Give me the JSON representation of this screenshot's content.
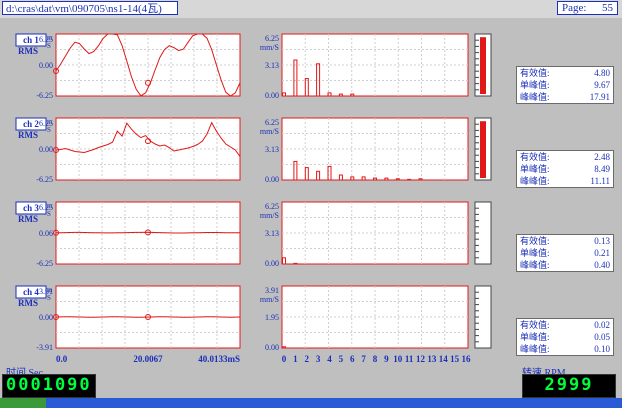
{
  "header": {
    "file_path": "d:\\cras\\dat\\vm\\090705\\ns1-14(4瓦)",
    "page_label": "Page:",
    "page_number": "55"
  },
  "colors": {
    "trace": "#e01818",
    "axis_text": "#1b2fb8",
    "bar_fill": "#e01818",
    "background": "#bfbfbf"
  },
  "channels": [
    {
      "label": "ch 1",
      "rms_label": "RMS",
      "side_marks": [
        "m",
        "S"
      ],
      "wave_ticks": [
        "6.25",
        "0.00",
        "-6.25"
      ],
      "spec_unit": "mm/S",
      "spec_ticks": [
        "6.25",
        "3.13",
        "0.00"
      ],
      "stats": [
        {
          "key": "有效值:",
          "value": "4.80"
        },
        {
          "key": "单峰值:",
          "value": "9.67"
        },
        {
          "key": "峰峰值:",
          "value": "17.91"
        }
      ],
      "level": 0.98,
      "spectrum": [
        0.05,
        0.58,
        0.28,
        0.52,
        0.05,
        0.03,
        0.03,
        0.0,
        0.0,
        0.0,
        0.0,
        0.0,
        0.0,
        0.0,
        0.0,
        0.0,
        0.0
      ],
      "wave": [
        -1.2,
        0.2,
        1.8,
        3.4,
        4.6,
        4.3,
        3.2,
        2.3,
        2.7,
        3.9,
        5.4,
        6.4,
        6.8,
        6.1,
        3.9,
        0.8,
        -2.4,
        -4.9,
        -6.2,
        -5.6,
        -3.6,
        -1.0,
        1.5,
        3.1,
        3.9,
        3.5,
        2.9,
        3.2,
        4.6,
        5.9,
        6.7,
        6.6,
        5.4,
        3.1,
        0.0,
        -3.0,
        -5.5,
        -6.4,
        -5.6,
        -3.6
      ]
    },
    {
      "label": "ch 2",
      "rms_label": "RMS",
      "side_marks": [
        "m",
        "S"
      ],
      "wave_ticks": [
        "6.25",
        "0.00",
        "-6.25"
      ],
      "spec_unit": "mm/S",
      "spec_ticks": [
        "6.25",
        "3.13",
        "0.00"
      ],
      "stats": [
        {
          "key": "有效值:",
          "value": "2.48"
        },
        {
          "key": "单峰值:",
          "value": "8.49"
        },
        {
          "key": "峰峰值:",
          "value": "11.11"
        }
      ],
      "level": 0.98,
      "spectrum": [
        0.0,
        0.3,
        0.2,
        0.14,
        0.22,
        0.08,
        0.05,
        0.05,
        0.03,
        0.03,
        0.02,
        0.01,
        0.02,
        0.0,
        0.0,
        0.0,
        0.0
      ],
      "wave": [
        -0.2,
        -0.1,
        0.1,
        -0.2,
        -0.5,
        -0.6,
        -0.7,
        -0.4,
        -0.1,
        0.3,
        0.6,
        0.9,
        1.4,
        3.6,
        2.6,
        5.2,
        4.0,
        3.0,
        2.3,
        2.7,
        1.6,
        1.0,
        0.6,
        0.8,
        0.3,
        -0.4,
        -0.2,
        0.0,
        0.2,
        0.5,
        0.9,
        1.6,
        3.0,
        5.3,
        3.6,
        2.2,
        1.0,
        0.4,
        -0.2,
        -1.5
      ]
    },
    {
      "label": "ch 3",
      "rms_label": "RMS",
      "side_marks": [
        "m",
        "S"
      ],
      "wave_ticks": [
        "6.25",
        "0.06",
        "-6.25"
      ],
      "spec_unit": "mm/S",
      "spec_ticks": [
        "6.25",
        "3.13",
        "0.00"
      ],
      "stats": [
        {
          "key": "有效值:",
          "value": "0.13"
        },
        {
          "key": "单峰值:",
          "value": "0.21"
        },
        {
          "key": "峰峰值:",
          "value": "0.40"
        }
      ],
      "level": 0.0,
      "spectrum": [
        0.1,
        0.01,
        0.0,
        0.0,
        0.0,
        0.0,
        0.0,
        0.0,
        0.0,
        0.0,
        0.0,
        0.0,
        0.0,
        0.0,
        0.0,
        0.0,
        0.0
      ],
      "wave": [
        0.06,
        0.07,
        0.09,
        0.11,
        0.12,
        0.12,
        0.1,
        0.08,
        0.06,
        0.04,
        0.03,
        0.02,
        0.03,
        0.04,
        0.06,
        0.08,
        0.1,
        0.12,
        0.13,
        0.14,
        0.12,
        0.1,
        0.08,
        0.05,
        0.02,
        0.0,
        -0.01,
        0.0,
        0.02,
        0.04,
        0.06,
        0.08,
        0.1,
        0.11,
        0.1,
        0.08,
        0.06,
        0.05,
        0.05,
        0.06
      ]
    },
    {
      "label": "ch 4",
      "rms_label": "RMS",
      "side_marks": [
        "m",
        "S"
      ],
      "wave_ticks": [
        "3.91",
        "0.00",
        "-3.91"
      ],
      "spec_unit": "mm/S",
      "spec_ticks": [
        "3.91",
        "1.95",
        "0.00"
      ],
      "stats": [
        {
          "key": "有效值:",
          "value": "0.02"
        },
        {
          "key": "单峰值:",
          "value": "0.05"
        },
        {
          "key": "峰峰值:",
          "value": "0.10"
        }
      ],
      "level": 0.0,
      "spectrum": [
        0.02,
        0.0,
        0.0,
        0.0,
        0.0,
        0.0,
        0.0,
        0.0,
        0.0,
        0.0,
        0.0,
        0.0,
        0.0,
        0.0,
        0.0,
        0.0,
        0.0
      ],
      "wave": [
        0.0,
        0.01,
        0.02,
        0.02,
        0.01,
        0.0,
        -0.01,
        -0.02,
        -0.02,
        -0.01,
        0.0,
        0.01,
        0.02,
        0.02,
        0.01,
        0.0,
        -0.01,
        -0.02,
        -0.02,
        -0.01,
        0.0,
        0.01,
        0.02,
        0.02,
        0.01,
        0.0,
        -0.01,
        -0.02,
        -0.02,
        -0.01,
        0.0,
        0.01,
        0.02,
        0.02,
        0.01,
        0.0,
        -0.01,
        -0.02,
        -0.01,
        0.0
      ]
    }
  ],
  "time_axis": {
    "ticks": [
      "0.0",
      "20.0067",
      "40.0133mS"
    ],
    "ticks_x": [
      0,
      20.0067,
      40.0133
    ]
  },
  "freq_axis": {
    "ticks": [
      "0",
      "1",
      "2",
      "3",
      "4",
      "5",
      "6",
      "7",
      "8",
      "9",
      "10",
      "11",
      "12",
      "13",
      "14",
      "15",
      "16"
    ]
  },
  "footer": {
    "time_label": "时间 Sec",
    "time_value": "0001090",
    "rpm_label": "转速 RPM",
    "rpm_value": "2999"
  }
}
